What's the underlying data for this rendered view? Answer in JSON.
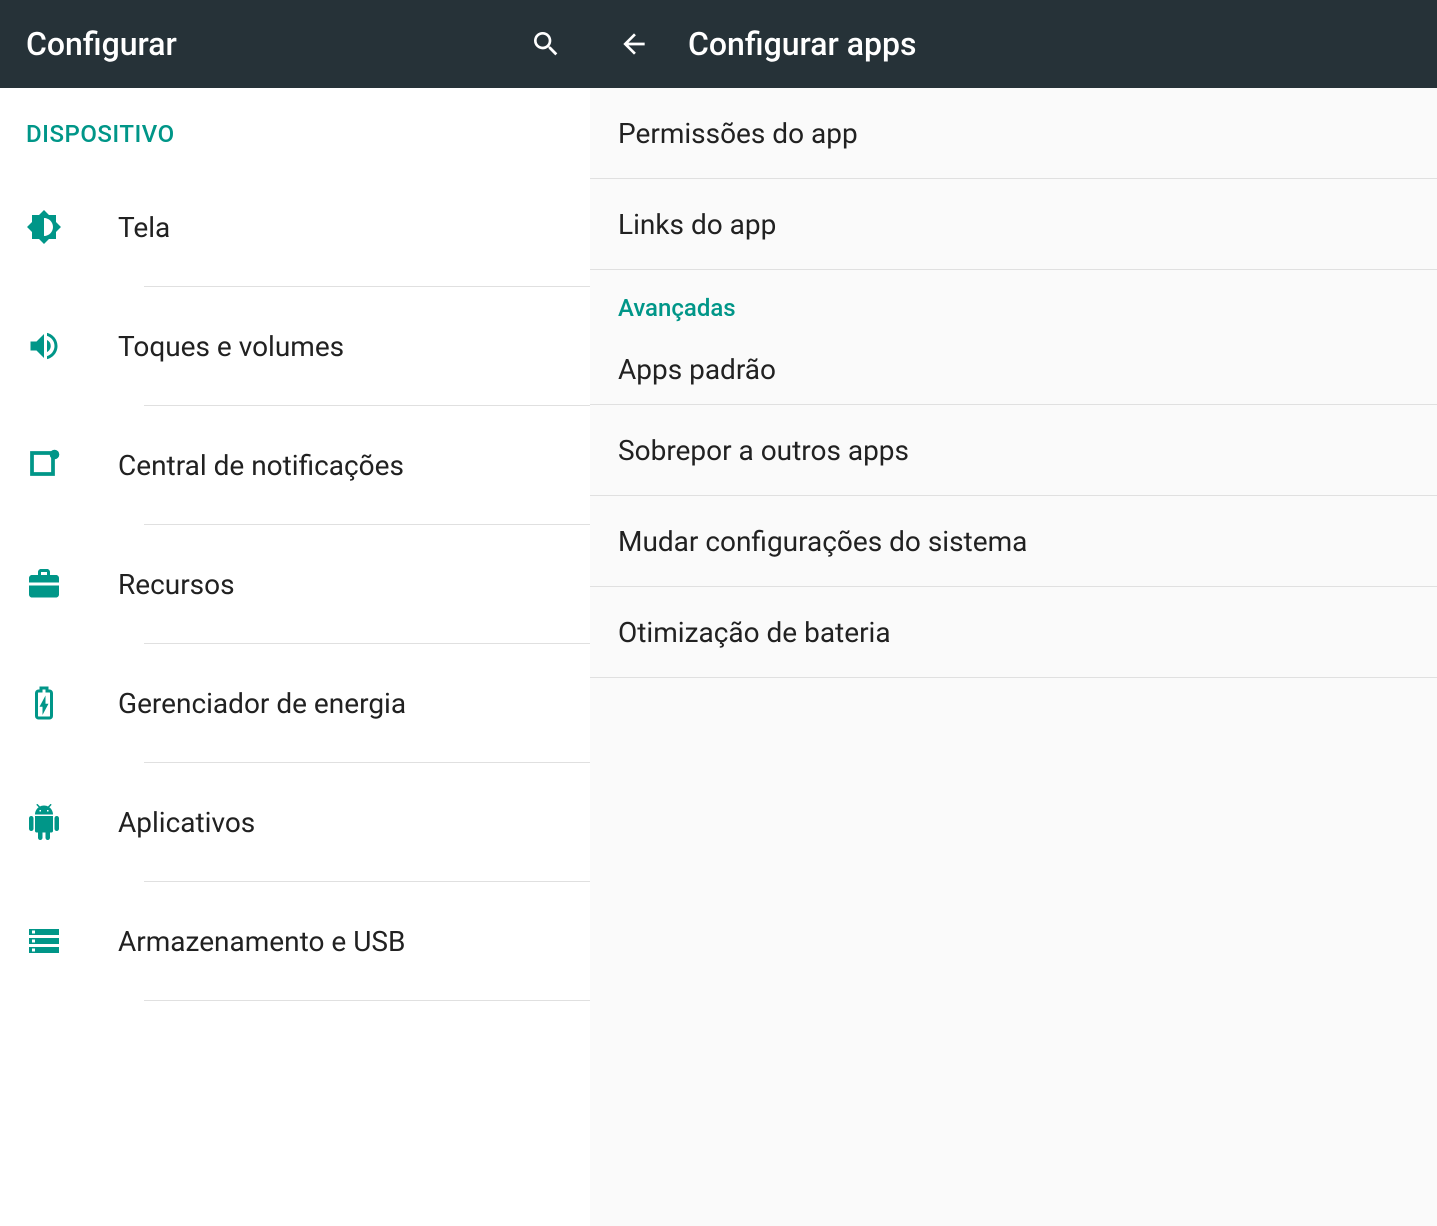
{
  "colors": {
    "accent": "#009688",
    "appbar": "#263238"
  },
  "left": {
    "appbar": {
      "title": "Configurar"
    },
    "section": "DISPOSITIVO",
    "items": [
      {
        "icon": "brightness-icon",
        "label": "Tela"
      },
      {
        "icon": "volume-icon",
        "label": "Toques e volumes"
      },
      {
        "icon": "notification-icon",
        "label": "Central de notificações"
      },
      {
        "icon": "briefcase-icon",
        "label": "Recursos"
      },
      {
        "icon": "battery-charging-icon",
        "label": "Gerenciador de energia"
      },
      {
        "icon": "android-icon",
        "label": "Aplicativos"
      },
      {
        "icon": "storage-icon",
        "label": "Armazenamento e USB"
      }
    ]
  },
  "right": {
    "appbar": {
      "title": "Configurar apps"
    },
    "items_top": [
      {
        "label": "Permissões do app"
      },
      {
        "label": "Links do app"
      }
    ],
    "section": "Avançadas",
    "items_advanced": [
      {
        "label": "Apps padrão"
      },
      {
        "label": "Sobrepor a outros apps"
      },
      {
        "label": "Mudar configurações do sistema"
      },
      {
        "label": "Otimização de bateria"
      }
    ]
  }
}
